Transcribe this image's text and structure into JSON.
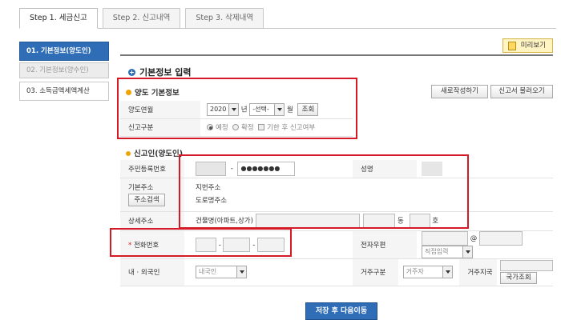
{
  "tabs": [
    {
      "label": "Step 1. 세금신고",
      "active": true
    },
    {
      "label": "Step 2. 신고내역",
      "active": false
    },
    {
      "label": "Step 3. 삭제내역",
      "active": false
    }
  ],
  "sidebar": {
    "items": [
      {
        "label": "01. 기본정보(양도인)"
      },
      {
        "label": "02. 기본정보(양수인)"
      },
      {
        "label": "03. 소득금액세액계산"
      }
    ]
  },
  "preview_label": "미리보기",
  "main_title": "기본정보 입력",
  "transfer": {
    "title": "양도 기본정보",
    "new_btn": "새로작성하기",
    "load_btn": "신고서 불러오기",
    "year_label": "양도연월",
    "year_value": "2020",
    "year_unit": "년",
    "month_value": "-선택-",
    "month_unit": "월",
    "lookup_btn": "조회",
    "type_label": "신고구분",
    "opt1": "예정",
    "opt2": "확정",
    "opt3": "기한 후 신고여부"
  },
  "reporter": {
    "title": "신고인(양도인)",
    "rrn_label": "주민등록번호",
    "rrn_dash": "-",
    "rrn_masked": "●●●●●●●",
    "name_label": "성명",
    "addr_label": "기본주소",
    "addr_search_btn": "주소검색",
    "jibun_label": "지번주소",
    "road_label": "도로명주소",
    "detail_label": "상세주소",
    "building_label": "건물명(아파트,상가)",
    "dong_unit": "동",
    "ho_unit": "호",
    "phone_label": "전화번호",
    "phone_req": "*",
    "phone_dash": "-",
    "email_label": "전자우편",
    "email_at": "@",
    "email_select": "직접입력",
    "nation_label": "내 · 외국인",
    "nation_value": "내국인",
    "residence_label": "거주구분",
    "residence_value": "거주자",
    "region_label": "거주지국",
    "country_btn": "국가조회"
  },
  "submit_label": "저장 후 다음이동",
  "colors": {
    "accent": "#2f6db7",
    "highlight": "#d41a26",
    "bullet": "#f0a400"
  }
}
